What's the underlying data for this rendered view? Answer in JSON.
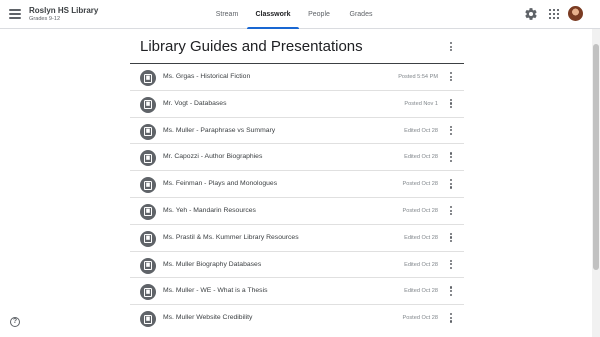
{
  "header": {
    "class_name": "Roslyn HS Library",
    "section": "Grades 9-12",
    "menu_icon": "hamburger-menu-icon",
    "tabs": [
      {
        "label": "Stream",
        "active": false
      },
      {
        "label": "Classwork",
        "active": true
      },
      {
        "label": "People",
        "active": false
      },
      {
        "label": "Grades",
        "active": false
      }
    ],
    "settings_icon": "gear-icon",
    "apps_icon": "apps-grid-icon",
    "avatar_icon": "user-avatar"
  },
  "topic": {
    "title": "Library Guides and Presentations",
    "more_icon": "more-vert-icon"
  },
  "materials": [
    {
      "title": "Ms. Grgas - Historical Fiction",
      "meta": "Posted 5:54 PM"
    },
    {
      "title": "Mr. Vogt - Databases",
      "meta": "Posted Nov 1"
    },
    {
      "title": "Ms. Muller - Paraphrase vs Summary",
      "meta": "Edited Oct 28"
    },
    {
      "title": "Mr. Capozzi - Author Biographies",
      "meta": "Edited Oct 28"
    },
    {
      "title": "Ms. Feinman - Plays and Monologues",
      "meta": "Posted Oct 28"
    },
    {
      "title": "Ms. Yeh - Mandarin Resources",
      "meta": "Posted Oct 28"
    },
    {
      "title": "Ms. Prastil & Ms. Kummer Library Resources",
      "meta": "Edited Oct 28"
    },
    {
      "title": "Ms. Muller Biography Databases",
      "meta": "Edited Oct 28"
    },
    {
      "title": "Ms. Muller - WE - What is a Thesis",
      "meta": "Edited Oct 28"
    },
    {
      "title": "Ms. Muller Website Credibility",
      "meta": "Posted Oct 28"
    }
  ],
  "material_icon": "material-book-icon",
  "help": {
    "label": "?",
    "icon": "help-icon"
  },
  "colors": {
    "accent": "#1967d2",
    "icon_bg": "#5f6368"
  }
}
